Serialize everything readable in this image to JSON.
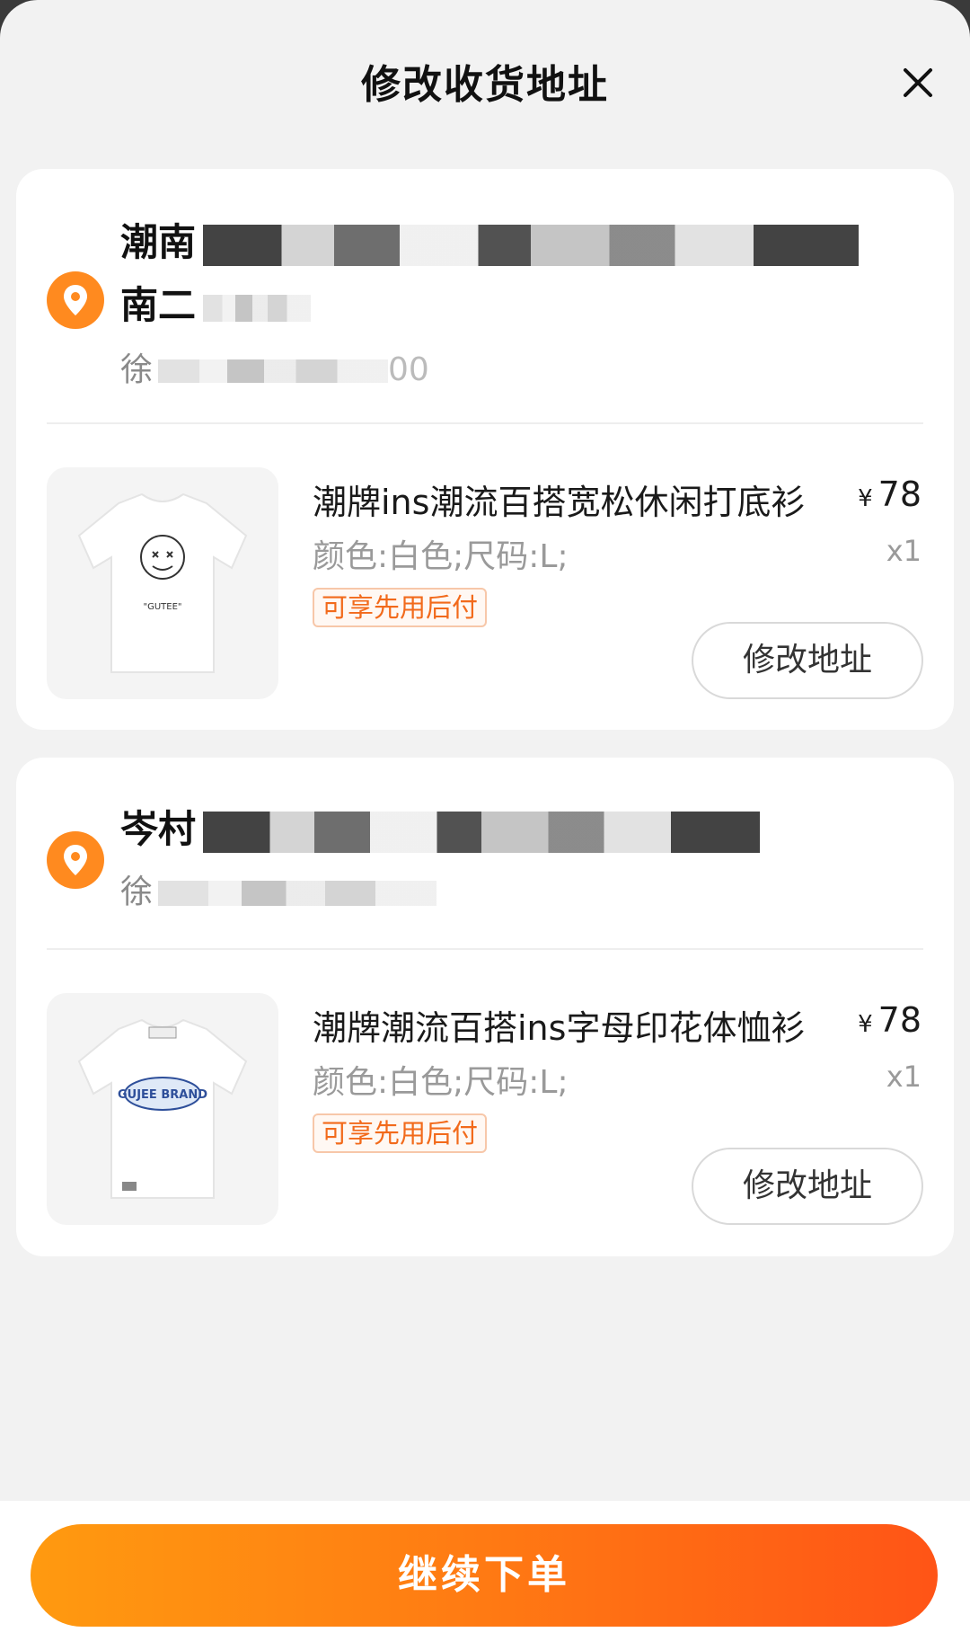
{
  "header": {
    "title": "修改收货地址",
    "close_icon": "close-icon"
  },
  "orders": [
    {
      "address_line1": "潮南",
      "address_line2": "南二",
      "receiver": "徐",
      "receiver_tail": "00",
      "product": {
        "name": "潮牌ins潮流百搭宽松休闲打底衫",
        "currency": "¥",
        "price": "78",
        "spec": "颜色:白色;尺码:L;",
        "qty": "x1",
        "badge": "可享先用后付",
        "print_text": "\"GUTEE\""
      },
      "modify_label": "修改地址"
    },
    {
      "address_line1": "岑村",
      "receiver": "徐",
      "product": {
        "name": "潮牌潮流百搭ins字母印花体恤衫",
        "currency": "¥",
        "price": "78",
        "spec": "颜色:白色;尺码:L;",
        "qty": "x1",
        "badge": "可享先用后付",
        "print_text": "GUJEE BRAND"
      },
      "modify_label": "修改地址"
    }
  ],
  "footer": {
    "submit_label": "继续下单"
  },
  "colors": {
    "accent": "#ff7a13",
    "location_icon": "#ff8a1f",
    "badge_text": "#f26a1b"
  }
}
